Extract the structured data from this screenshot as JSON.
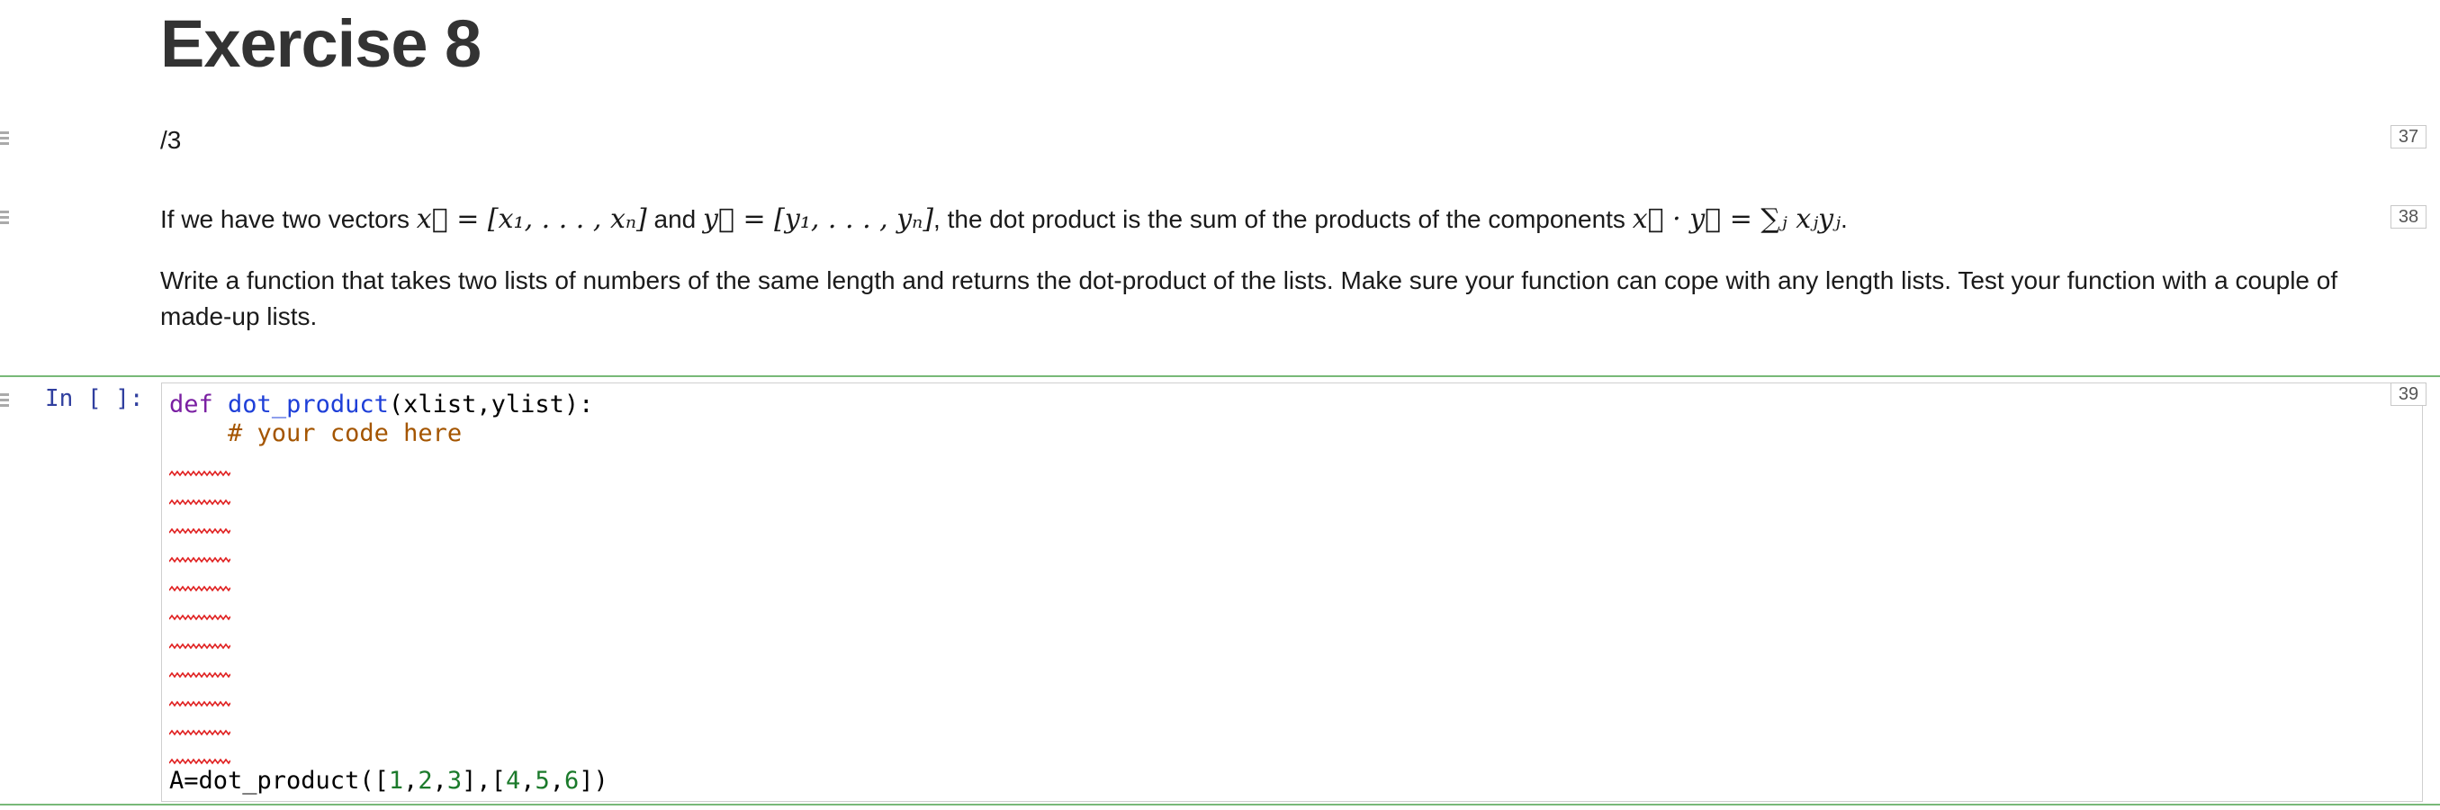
{
  "heading": "Exercise 8",
  "cells": [
    {
      "number": "37"
    },
    {
      "number": "38"
    },
    {
      "number": "39"
    }
  ],
  "points": "/3",
  "intro": {
    "before": "If we have two vectors ",
    "x_vec": "x⃗ = [x₁, . . . , xₙ]",
    "mid": " and ",
    "y_vec": "y⃗ = [y₁, . . . , yₙ]",
    "after": ", the dot product is the sum of the products of the components ",
    "formula": "x⃗ · y⃗ = ∑ⱼ xⱼyⱼ",
    "end": "."
  },
  "instructions": "Write a function that takes two lists of numbers of the same length and returns the dot-product of the lists. Make sure your function can cope with any length lists. Test your function with a couple of made-up lists.",
  "code_cell": {
    "prompt": "In [ ]:",
    "line1": {
      "keyword": "def",
      "name": "dot_product",
      "args": "(xlist,ylist):"
    },
    "line2": {
      "indent": "    ",
      "comment": "# your code here"
    },
    "last_line": {
      "prefix": "A=dot_product([",
      "a1": "1",
      "a2": "2",
      "a3": "3",
      "mid": "],[",
      "b1": "4",
      "b2": "5",
      "b3": "6",
      "suffix": "])"
    }
  },
  "colors": {
    "keyword": "#7a1fa2",
    "function": "#1e3fd8",
    "comment": "#a45500",
    "number": "#1b7a2b",
    "prompt": "#303f9f",
    "cell_border": "#78b978",
    "squiggle": "#e02020"
  },
  "icons": [
    "drag-handle-icon",
    "error-squiggle-icon"
  ]
}
